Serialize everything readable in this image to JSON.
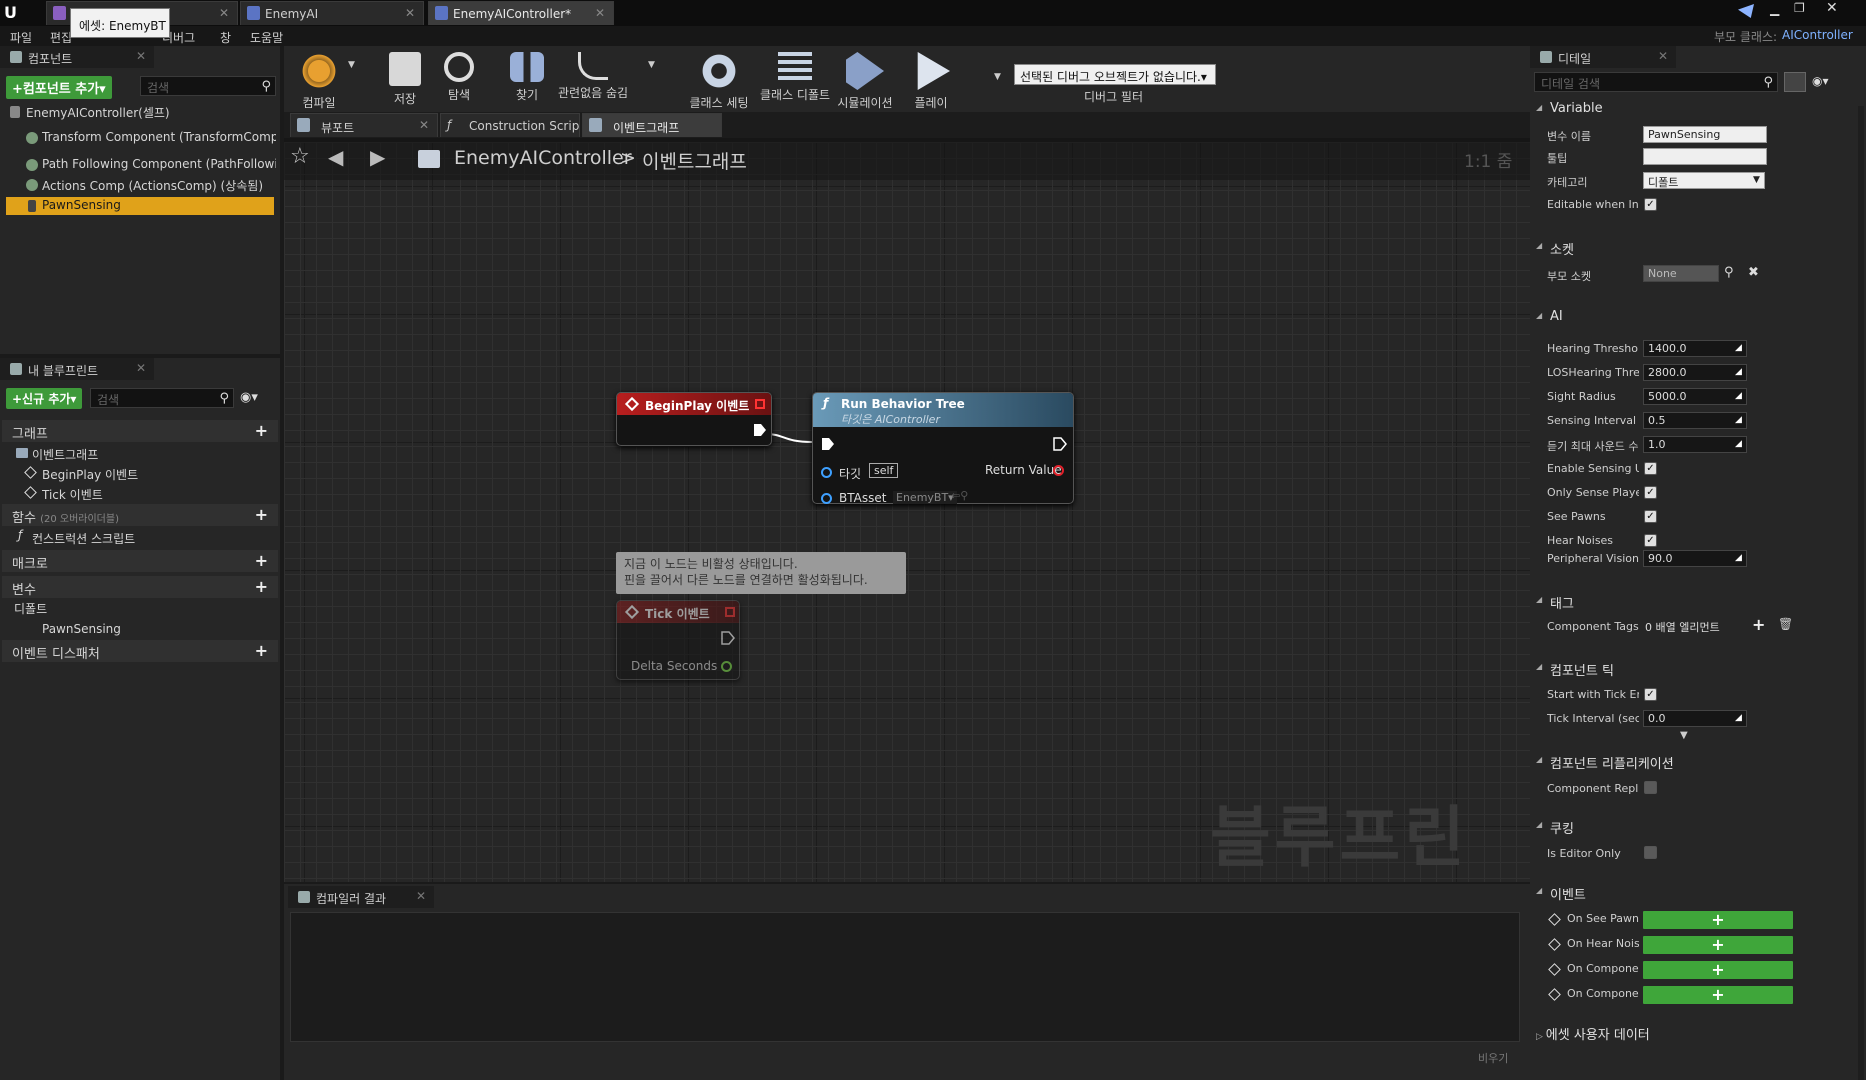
{
  "tabs": [
    {
      "label": "",
      "tooltip": "에셋: EnemyBT"
    },
    {
      "label": "EnemyAI"
    },
    {
      "label": "EnemyAIController*"
    }
  ],
  "window": {
    "parent_class_label": "부모 클래스:",
    "parent_class_value": "AIController"
  },
  "menu": [
    "파일",
    "편집",
    "디버그",
    "창",
    "도움말"
  ],
  "components_panel": {
    "title": "컴포넌트",
    "add_button": "+컴포넌트 추가▾",
    "search_placeholder": "검색",
    "items": [
      "EnemyAIController(셀프)",
      "Transform Component (TransformCompon",
      "Path Following Component (PathFollowing",
      "Actions Comp (ActionsComp) (상속됨)",
      "PawnSensing"
    ]
  },
  "myblueprint_panel": {
    "title": "내 블루프린트",
    "add_button": "+신규 추가▾",
    "search_placeholder": "검색",
    "sections": {
      "graphs": "그래프",
      "event_graph": "이벤트그래프",
      "begin_play": "BeginPlay 이벤트",
      "tick": "Tick 이벤트",
      "functions": "함수",
      "functions_note": "(20 오버라이더블)",
      "construction": "컨스트럭션 스크립트",
      "macros": "매크로",
      "variables": "변수",
      "default": "디폴트",
      "pawn_sensing": "PawnSensing",
      "dispatchers": "이벤트 디스패처"
    }
  },
  "toolbar": {
    "buttons": [
      "컴파일",
      "저장",
      "탐색",
      "찾기",
      "관련없음 숨김",
      "클래스 세팅",
      "클래스 디폴트",
      "시뮬레이션",
      "플레이"
    ],
    "debug_dropdown": "선택된 디버그 오브젝트가 없습니다.▾",
    "debug_filter": "디버그 필터"
  },
  "editor_tabs": [
    "뷰포트",
    "Construction Scrip",
    "이벤트그래프"
  ],
  "breadcrumb": {
    "blueprint": "EnemyAIController",
    "separator": ">",
    "graph": "이벤트그래프",
    "zoom": "1:1 줌"
  },
  "graph": {
    "watermark": "블루프린트",
    "begin_play_node": {
      "title": "BeginPlay 이벤트"
    },
    "run_bt_node": {
      "title": "Run Behavior Tree",
      "subtitle": "타깃은 AIController",
      "target_label": "타깃",
      "target_value": "self",
      "return_label": "Return Value",
      "btasset_label": "BTAsset",
      "btasset_value": "EnemyBT▾"
    },
    "disabled_comment": {
      "line1": "지금 이 노드는 비활성 상태입니다.",
      "line2": "핀을 끌어서 다른 노드를 연결하면 활성화됩니다."
    },
    "tick_node": {
      "title": "Tick 이벤트",
      "delta_label": "Delta Seconds"
    }
  },
  "compiler_panel": {
    "title": "컴파일러 결과",
    "clear": "비우기"
  },
  "details": {
    "title": "디테일",
    "search_placeholder": "디테일 검색",
    "variable_section": "Variable",
    "variable_name_label": "변수 이름",
    "variable_name": "PawnSensing",
    "tooltip_label": "툴팁",
    "tooltip_value": "",
    "category_label": "카테고리",
    "category_value": "디폴트",
    "editable_label": "Editable when Inhe",
    "socket_section": "소켓",
    "parent_socket_label": "부모 소켓",
    "parent_socket_value": "None",
    "ai_section": "AI",
    "ai_rows": [
      {
        "label": "Hearing Threshold",
        "value": "1400.0"
      },
      {
        "label": "LOSHearing Thres",
        "value": "2800.0"
      },
      {
        "label": "Sight Radius",
        "value": "5000.0"
      },
      {
        "label": "Sensing Interval",
        "value": "0.5"
      },
      {
        "label": "듣기 최대 사운드 수",
        "value": "1.0"
      }
    ],
    "ai_checks": [
      {
        "label": "Enable Sensing Up",
        "checked": true
      },
      {
        "label": "Only Sense Player",
        "checked": true
      },
      {
        "label": "See Pawns",
        "checked": true
      },
      {
        "label": "Hear Noises",
        "checked": true
      }
    ],
    "peripheral_label": "Peripheral Vision A",
    "peripheral_value": "90.0",
    "tags_section": "태그",
    "component_tags_label": "Component Tags",
    "component_tags_value": "0 배열 엘리먼트",
    "tick_section": "컴포넌트 틱",
    "start_tick_label": "Start with Tick En",
    "tick_interval_label": "Tick Interval (secs",
    "tick_interval_value": "0.0",
    "replication_section": "컴포넌트 리플리케이션",
    "component_replic_label": "Component Replic",
    "cooking_section": "쿠킹",
    "is_editor_only_label": "Is Editor Only",
    "events_section": "이벤트",
    "events": [
      "On See Pawn",
      "On Hear Nois",
      "On Componer",
      "On Componer"
    ],
    "asset_user_data": "에셋 사용자 데이터"
  }
}
